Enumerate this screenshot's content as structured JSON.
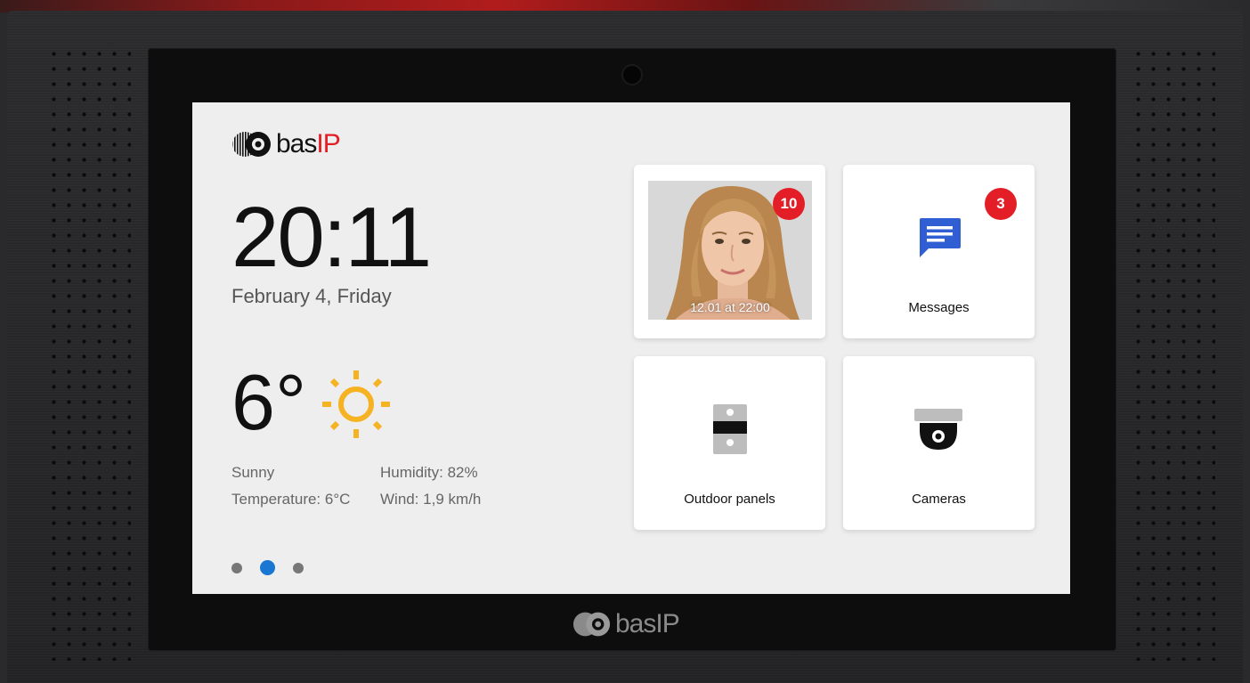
{
  "brand": {
    "name_prefix": "bas",
    "name_suffix": "IP"
  },
  "clock": {
    "time": "20:11",
    "date": "February 4, Friday"
  },
  "weather": {
    "temperature_big": "6°",
    "condition": "Sunny",
    "temperature_detail": "Temperature: 6°C",
    "humidity": "Humidity: 82%",
    "wind": "Wind: 1,9 km/h",
    "icon": "sun-icon"
  },
  "pagination": {
    "pages": 3,
    "active_index": 1
  },
  "tiles": {
    "calls": {
      "badge": "10",
      "timestamp": "12.01 at 22:00",
      "icon": "visitor-photo"
    },
    "messages": {
      "label": "Messages",
      "badge": "3",
      "icon": "message-icon"
    },
    "outdoor_panels": {
      "label": "Outdoor panels",
      "icon": "outdoor-panel-icon"
    },
    "cameras": {
      "label": "Cameras",
      "icon": "dome-camera-icon"
    }
  },
  "colors": {
    "accent": "#1976d2",
    "badge": "#e41e26",
    "sun": "#f5b323",
    "message": "#2f5fd3"
  }
}
